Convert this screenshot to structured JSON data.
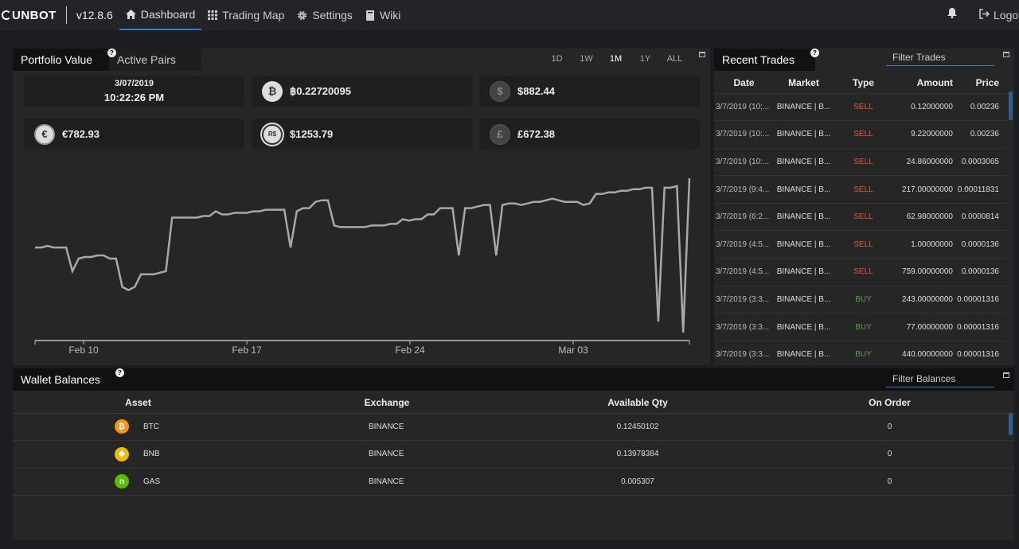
{
  "nav": {
    "brand": "UNBOT",
    "version": "v12.8.6",
    "items": [
      {
        "label": "Dashboard",
        "icon": "home-icon"
      },
      {
        "label": "Trading Map",
        "icon": "grid-icon"
      },
      {
        "label": "Settings",
        "icon": "gear-icon"
      },
      {
        "label": "Wiki",
        "icon": "book-icon"
      }
    ],
    "logout": "Logout"
  },
  "portfolio": {
    "tab_active": "Portfolio Value",
    "tab_inactive": "Active Pairs",
    "timeframes": [
      "1D",
      "1W",
      "1M",
      "1Y",
      "ALL"
    ],
    "selected_timeframe": "1M",
    "date": "3/07/2019",
    "time": "10:22:26 PM",
    "btc_value": "฿0.22720095",
    "usd_value": "$882.44",
    "eur_value": "€782.93",
    "brl_value": "$1253.79",
    "gbp_value": "£672.38",
    "icons": {
      "btc": "bitcoin-icon",
      "usd": "dollar-icon",
      "eur": "euro-icon",
      "brl": "real-icon",
      "gbp": "pound-icon"
    }
  },
  "chart_data": {
    "type": "line",
    "x_ticks": [
      "Feb 10",
      "Feb 17",
      "Feb 24",
      "Mar 03"
    ],
    "series": [
      {
        "values": [
          0.55,
          0.55,
          0.56,
          0.55,
          0.55,
          0.55,
          0.4,
          0.48,
          0.49,
          0.49,
          0.5,
          0.5,
          0.48,
          0.48,
          0.3,
          0.28,
          0.3,
          0.38,
          0.38,
          0.38,
          0.39,
          0.4,
          0.74,
          0.74,
          0.74,
          0.74,
          0.74,
          0.75,
          0.75,
          0.78,
          0.76,
          0.76,
          0.77,
          0.77,
          0.77,
          0.78,
          0.78,
          0.79,
          0.79,
          0.79,
          0.79,
          0.55,
          0.78,
          0.8,
          0.8,
          0.84,
          0.85,
          0.85,
          0.69,
          0.68,
          0.68,
          0.68,
          0.68,
          0.68,
          0.69,
          0.69,
          0.69,
          0.7,
          0.7,
          0.73,
          0.72,
          0.73,
          0.73,
          0.76,
          0.76,
          0.8,
          0.8,
          0.8,
          0.5,
          0.8,
          0.8,
          0.81,
          0.82,
          0.82,
          0.5,
          0.82,
          0.83,
          0.83,
          0.82,
          0.83,
          0.84,
          0.84,
          0.85,
          0.86,
          0.85,
          0.84,
          0.84,
          0.84,
          0.82,
          0.83,
          0.89,
          0.89,
          0.9,
          0.9,
          0.91,
          0.91,
          0.92,
          0.92,
          0.93,
          0.93,
          0.08,
          0.93,
          0.93,
          0.94,
          0.01,
          0.99
        ]
      }
    ]
  },
  "trades": {
    "title": "Recent Trades",
    "filter_placeholder": "Filter Trades",
    "headers": [
      "Date",
      "Market",
      "Type",
      "Amount",
      "Price"
    ],
    "rows": [
      [
        "3/7/2019 (10:...",
        "BINANCE | B...",
        "SELL",
        "0.12000000",
        "0.00236"
      ],
      [
        "3/7/2019 (10:...",
        "BINANCE | B...",
        "SELL",
        "9.22000000",
        "0.00236"
      ],
      [
        "3/7/2019 (10:...",
        "BINANCE | B...",
        "SELL",
        "24.86000000",
        "0.0003065"
      ],
      [
        "3/7/2019 (9:4...",
        "BINANCE | B...",
        "SELL",
        "217.00000000",
        "0.00011831"
      ],
      [
        "3/7/2019 (6:2...",
        "BINANCE | B...",
        "SELL",
        "62.98000000",
        "0.0000814"
      ],
      [
        "3/7/2019 (4:5...",
        "BINANCE | B...",
        "SELL",
        "1.00000000",
        "0.0000136"
      ],
      [
        "3/7/2019 (4:5...",
        "BINANCE | B...",
        "SELL",
        "759.00000000",
        "0.0000136"
      ],
      [
        "3/7/2019 (3:3...",
        "BINANCE | B...",
        "BUY",
        "243.00000000",
        "0.00001316"
      ],
      [
        "3/7/2019 (3:3...",
        "BINANCE | B...",
        "BUY",
        "77.00000000",
        "0.00001316"
      ],
      [
        "3/7/2019 (3:3...",
        "BINANCE | B...",
        "BUY",
        "440.00000000",
        "0.00001316"
      ]
    ]
  },
  "wallet": {
    "title": "Wallet Balances",
    "filter_placeholder": "Filter Balances",
    "headers": [
      "Asset",
      "Exchange",
      "Available Qty",
      "On Order"
    ],
    "rows": [
      {
        "asset": "BTC",
        "exchange": "BINANCE",
        "qty": "0.12450102",
        "on_order": "0",
        "color": "#f2931a",
        "icon": "btc-icon"
      },
      {
        "asset": "BNB",
        "exchange": "BINANCE",
        "qty": "0.13978384",
        "on_order": "0",
        "color": "#f0b90b",
        "icon": "bnb-icon"
      },
      {
        "asset": "GAS",
        "exchange": "BINANCE",
        "qty": "0.005307",
        "on_order": "0",
        "color": "#58bf00",
        "icon": "gas-icon"
      }
    ]
  },
  "colors": {
    "accent": "#2f7bd1",
    "sell": "#e05a3a",
    "buy": "#5aa04a"
  }
}
